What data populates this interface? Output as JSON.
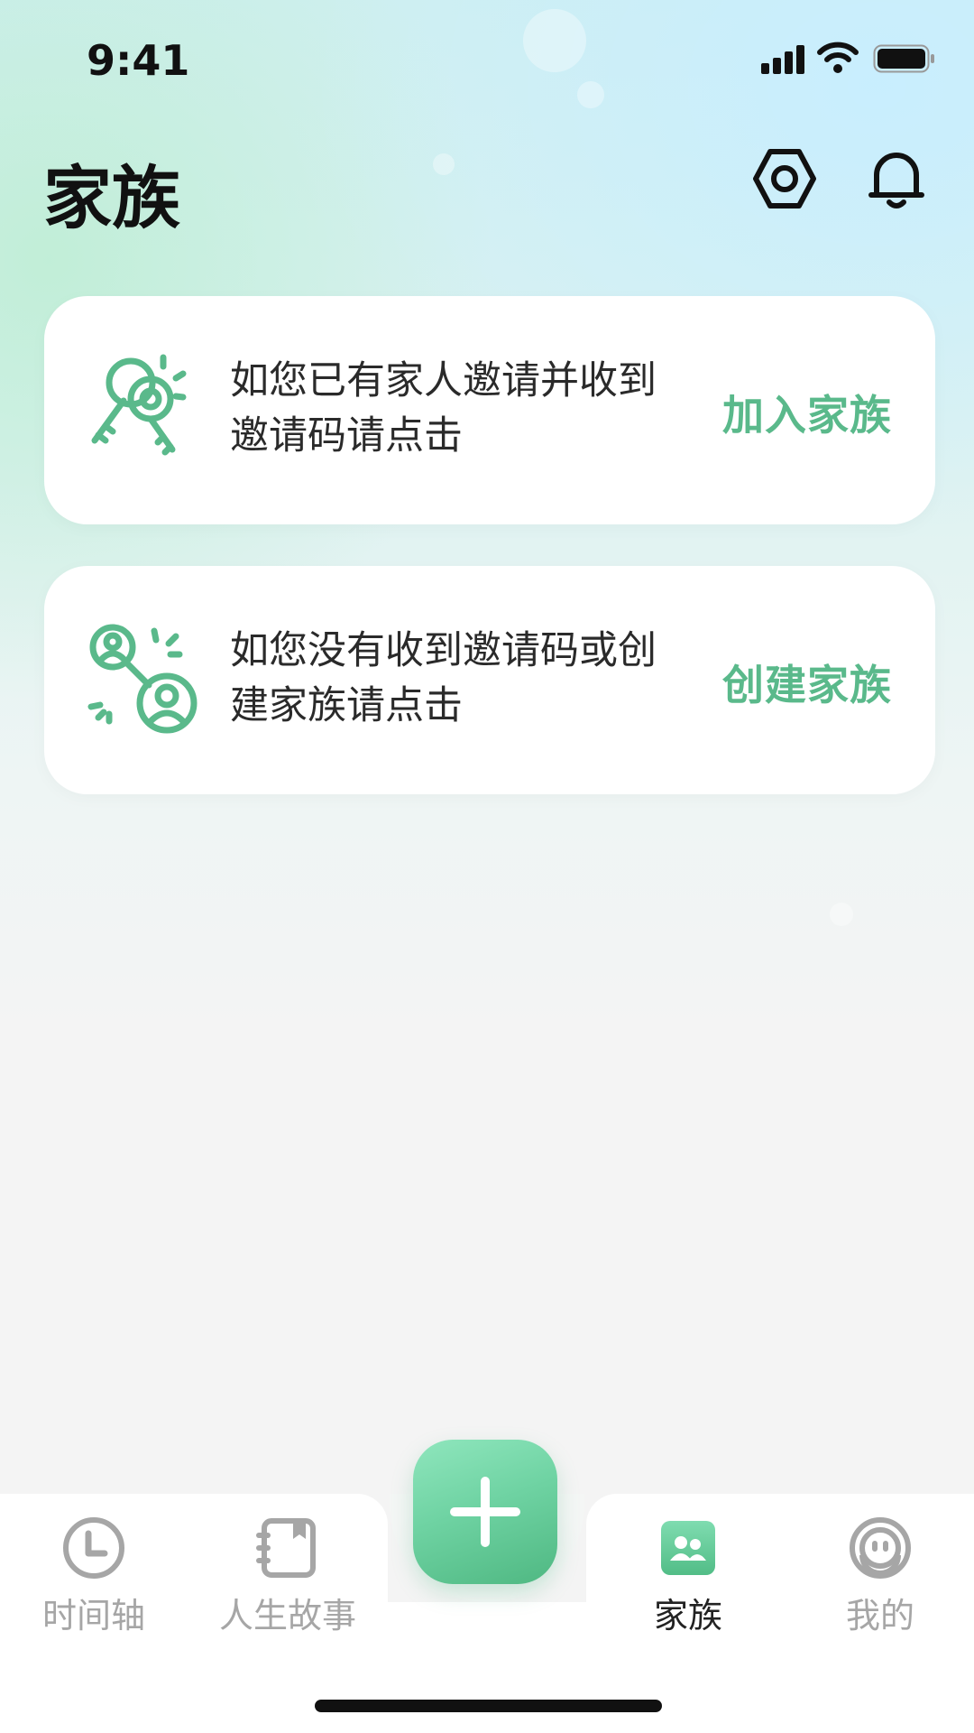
{
  "status_bar": {
    "time": "9:41",
    "icons": [
      "signal-icon",
      "wifi-icon",
      "battery-icon"
    ]
  },
  "header": {
    "title": "家族",
    "actions": [
      "settings-icon",
      "bell-icon"
    ]
  },
  "cards": [
    {
      "icon": "keys-icon",
      "description": "如您已有家人邀请并收到邀请码请点击",
      "action_label": "加入家族"
    },
    {
      "icon": "connect-users-icon",
      "description": "如您没有收到邀请码或创建家族请点击",
      "action_label": "创建家族"
    }
  ],
  "tab_bar": {
    "items": [
      {
        "label": "时间轴",
        "icon": "clock-icon",
        "active": false
      },
      {
        "label": "人生故事",
        "icon": "notebook-icon",
        "active": false
      },
      {
        "label": "家族",
        "icon": "family-icon",
        "active": true
      },
      {
        "label": "我的",
        "icon": "face-icon",
        "active": false
      }
    ],
    "center_action": "plus-icon"
  },
  "colors": {
    "accent": "#5ab98b",
    "fab_gradient_start": "#8fe6bd",
    "fab_gradient_end": "#4fb882",
    "text_primary": "#111111",
    "text_muted": "#a6a6a6"
  }
}
